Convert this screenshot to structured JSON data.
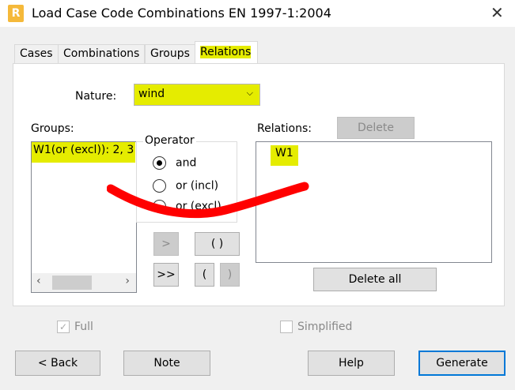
{
  "window": {
    "title": "Load Case Code Combinations EN 1997-1:2004",
    "logo": "R"
  },
  "tabs": [
    "Cases",
    "Combinations",
    "Groups",
    "Relations"
  ],
  "nature": {
    "label": "Nature:",
    "value": "wind"
  },
  "groups": {
    "label": "Groups:",
    "items": [
      "W1(or (excl)): 2, 3"
    ]
  },
  "operator": {
    "label": "Operator",
    "options": [
      "and",
      "or (incl)",
      "or (excl)"
    ],
    "selected": "and"
  },
  "buttons": {
    "add": ">",
    "add_all": ">>",
    "parens": "( )",
    "open_paren": "(",
    "close_paren": ")",
    "delete": "Delete",
    "delete_all": "Delete all",
    "back": "< Back",
    "note": "Note",
    "help": "Help",
    "generate": "Generate"
  },
  "relations": {
    "label": "Relations:",
    "items": [
      "W1"
    ]
  },
  "options": {
    "full": "Full",
    "simplified": "Simplified"
  }
}
